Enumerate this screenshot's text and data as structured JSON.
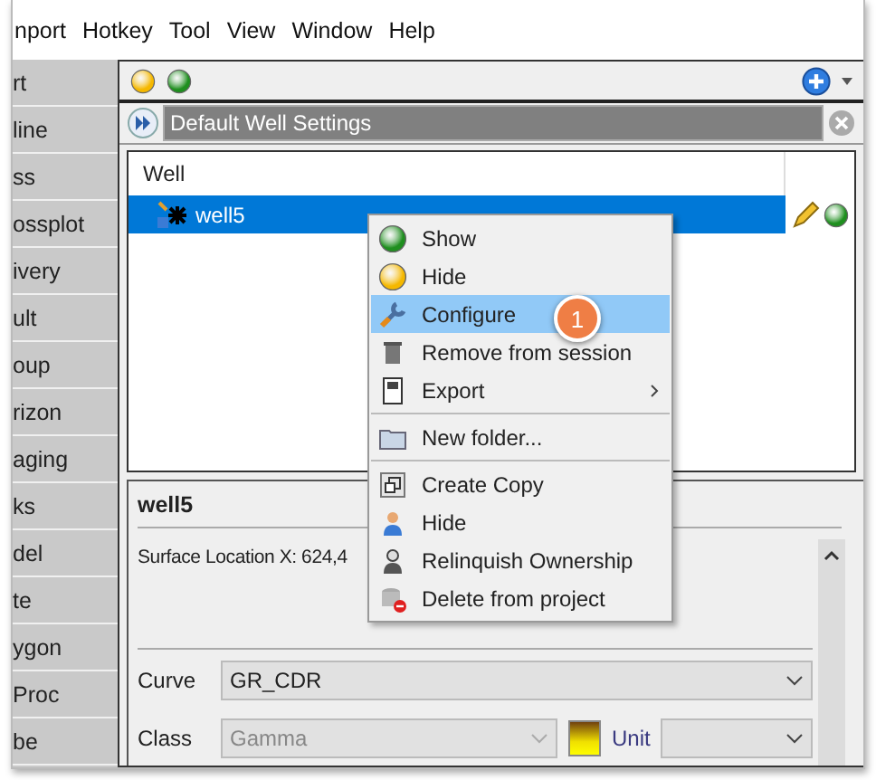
{
  "menu_bar": [
    "nport",
    "Hotkey",
    "Tool",
    "View",
    "Window",
    "Help"
  ],
  "sidebar": {
    "items": [
      "rt",
      "line",
      "ss",
      "ossplot",
      "ivery",
      "ult",
      "oup",
      "rizon",
      "aging",
      "ks",
      "del",
      "te",
      "ygon",
      "Proc",
      "be"
    ]
  },
  "filter": {
    "value": "Default Well Settings"
  },
  "tree": {
    "header": "Well",
    "rows": [
      {
        "label": "well5",
        "selected": true
      }
    ]
  },
  "context_menu": {
    "items": [
      {
        "kind": "item",
        "label": "Show",
        "selected": false
      },
      {
        "kind": "item",
        "label": "Hide",
        "selected": false
      },
      {
        "kind": "item",
        "label": "Configure",
        "selected": true
      },
      {
        "kind": "item",
        "label": "Remove from session",
        "selected": false
      },
      {
        "kind": "submenu",
        "label": "Export",
        "selected": false
      },
      {
        "kind": "separator"
      },
      {
        "kind": "item",
        "label": "New folder...",
        "selected": false
      },
      {
        "kind": "separator"
      },
      {
        "kind": "item",
        "label": "Create Copy",
        "selected": false
      },
      {
        "kind": "item",
        "label": "Hide",
        "selected": false
      },
      {
        "kind": "item",
        "label": "Relinquish Ownership",
        "selected": false
      },
      {
        "kind": "item",
        "label": "Delete from project",
        "selected": false
      }
    ]
  },
  "step_badge": "1",
  "details": {
    "title": "well5",
    "surface_location": "Surface Location X: 624,4",
    "fields": [
      {
        "label": "Curve",
        "value": "GR_CDR",
        "disabled": false
      },
      {
        "label": "Class",
        "value": "Gamma",
        "disabled": true
      }
    ],
    "unit": {
      "label": "Unit"
    }
  }
}
